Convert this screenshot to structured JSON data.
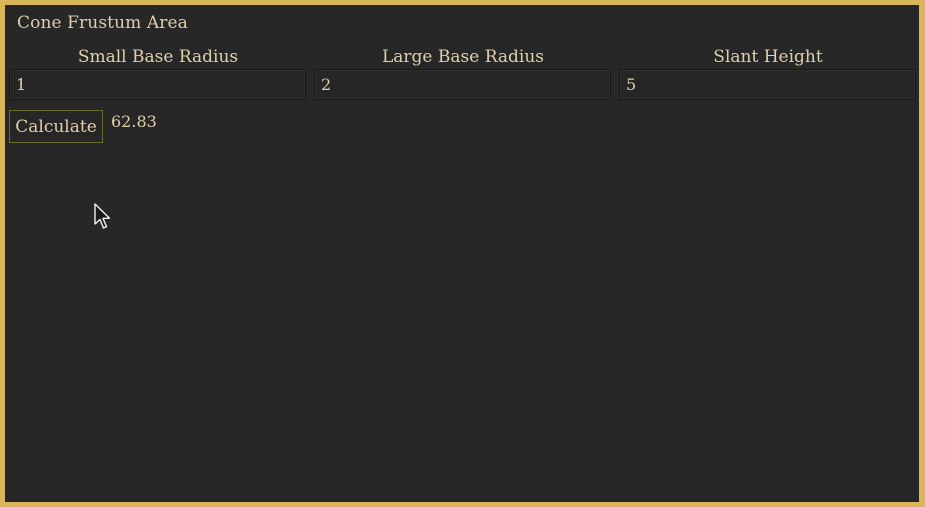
{
  "app": {
    "title": "Cone Frustum Area"
  },
  "fields": [
    {
      "label": "Small Base Radius",
      "value": "1"
    },
    {
      "label": "Large Base Radius",
      "value": "2"
    },
    {
      "label": "Slant Height",
      "value": "5"
    }
  ],
  "actions": {
    "calculate_label": "Calculate"
  },
  "result": {
    "value": "62.83"
  },
  "colors": {
    "frame": "#d9b65a",
    "background": "#272727",
    "text": "#e2ceab",
    "button_border": "#6a6a2a"
  },
  "icons": {
    "cursor": "mouse-pointer-icon"
  }
}
